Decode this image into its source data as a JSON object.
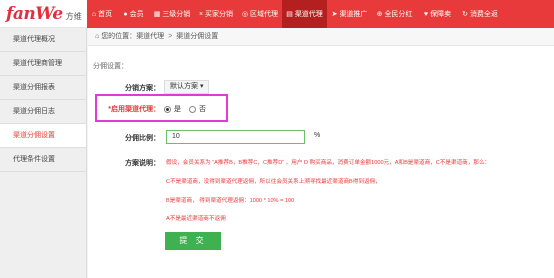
{
  "brand": {
    "logo": "fanWe",
    "logo_cn": "方维"
  },
  "nav": [
    {
      "label": "首页",
      "icon": "home-icon",
      "glyph": "⌂",
      "active": false
    },
    {
      "label": "会员",
      "icon": "user-icon",
      "glyph": "●",
      "active": false
    },
    {
      "label": "三级分销",
      "icon": "distribution-icon",
      "glyph": "▦",
      "active": false
    },
    {
      "label": "买家分销",
      "icon": "buyer-icon",
      "glyph": "×",
      "active": false
    },
    {
      "label": "区域代理",
      "icon": "region-icon",
      "glyph": "◎",
      "active": false
    },
    {
      "label": "渠道代理",
      "icon": "channel-icon",
      "glyph": "▤",
      "active": true
    },
    {
      "label": "渠道推广",
      "icon": "promote-icon",
      "glyph": "➤",
      "active": false
    },
    {
      "label": "全民分红",
      "icon": "globe-icon",
      "glyph": "⊕",
      "active": false
    },
    {
      "label": "保障卖",
      "icon": "shield-icon",
      "glyph": "♥",
      "active": false
    },
    {
      "label": "消费全返",
      "icon": "refund-icon",
      "glyph": "↻",
      "active": false
    }
  ],
  "sidebar": {
    "items": [
      {
        "label": "渠道代理概况",
        "active": false
      },
      {
        "label": "渠道代理商管理",
        "active": false
      },
      {
        "label": "渠道分佣报表",
        "active": false
      },
      {
        "label": "渠道分佣日志",
        "active": false
      },
      {
        "label": "渠道分佣设置",
        "active": true
      },
      {
        "label": "代理条件设置",
        "active": false
      }
    ]
  },
  "breadcrumb": {
    "prefix": "您的位置：",
    "level1": "渠道代理",
    "sep": ">",
    "level2": "渠道分佣设置"
  },
  "form": {
    "section_title": "分佣设置：",
    "plan_label": "分销方案：",
    "plan_value": "默认方案",
    "enable_label": "*启用渠道代理：",
    "opt_yes": "是",
    "opt_no": "否",
    "enable_value": "是",
    "ratio_label": "分佣比例：",
    "ratio_value": "10",
    "ratio_unit": "%",
    "explain_label": "方案说明：",
    "explain_lines": [
      "假设，会员关系为 “A推荐B，B推荐C，C推荐D” ，用户 D 购买商品，消费订单金额1000元，A和B是渠道商，C不是渠道商，那么：",
      "C不是渠道商，没得到渠道代理返佣，所以往会员关系上溯寻找最近渠道商B得到返佣，",
      "B是渠道商， 得到渠道代理返佣：1000 * 10% = 100",
      "A不是最近渠道商不返佣"
    ],
    "submit_label": "提 交"
  },
  "colors": {
    "accent": "#e83a3a",
    "nav_active": "#b41f1f",
    "highlight": "#e23ad7",
    "submit": "#3fb150"
  }
}
